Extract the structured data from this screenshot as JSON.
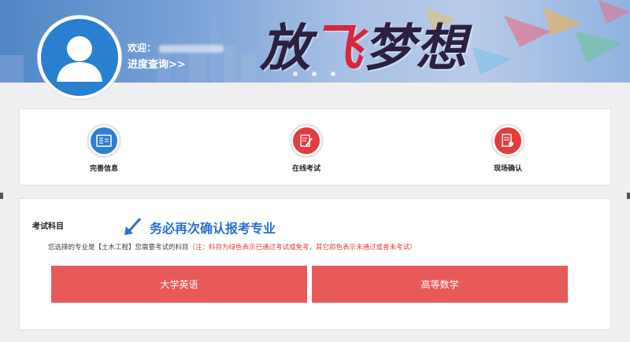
{
  "header": {
    "welcome_label": "欢迎：",
    "progress_link": "进度查询>>",
    "slogan_part1": "放",
    "slogan_part2": "飞",
    "slogan_part3": "梦想"
  },
  "steps": [
    {
      "label": "完善信息",
      "icon": "id-card-icon",
      "color": "#2d7fd3"
    },
    {
      "label": "在线考试",
      "icon": "exam-pen-icon",
      "color": "#e43d3d"
    },
    {
      "label": "现场确认",
      "icon": "confirm-doc-icon",
      "color": "#e43d3d"
    }
  ],
  "subjects": {
    "section_title": "考试科目",
    "notice": "务必再次确认报考专业",
    "desc_prefix": "您选择的专业是【土木工程】您需要考试的科目",
    "desc_note": "（注：科目为绿色表示已通过考试或免考，其它颜色表示未通过或者未考试）",
    "buttons": [
      {
        "label": "大学英语",
        "color": "#e85a5a"
      },
      {
        "label": "高等数学",
        "color": "#e85a5a"
      }
    ]
  }
}
